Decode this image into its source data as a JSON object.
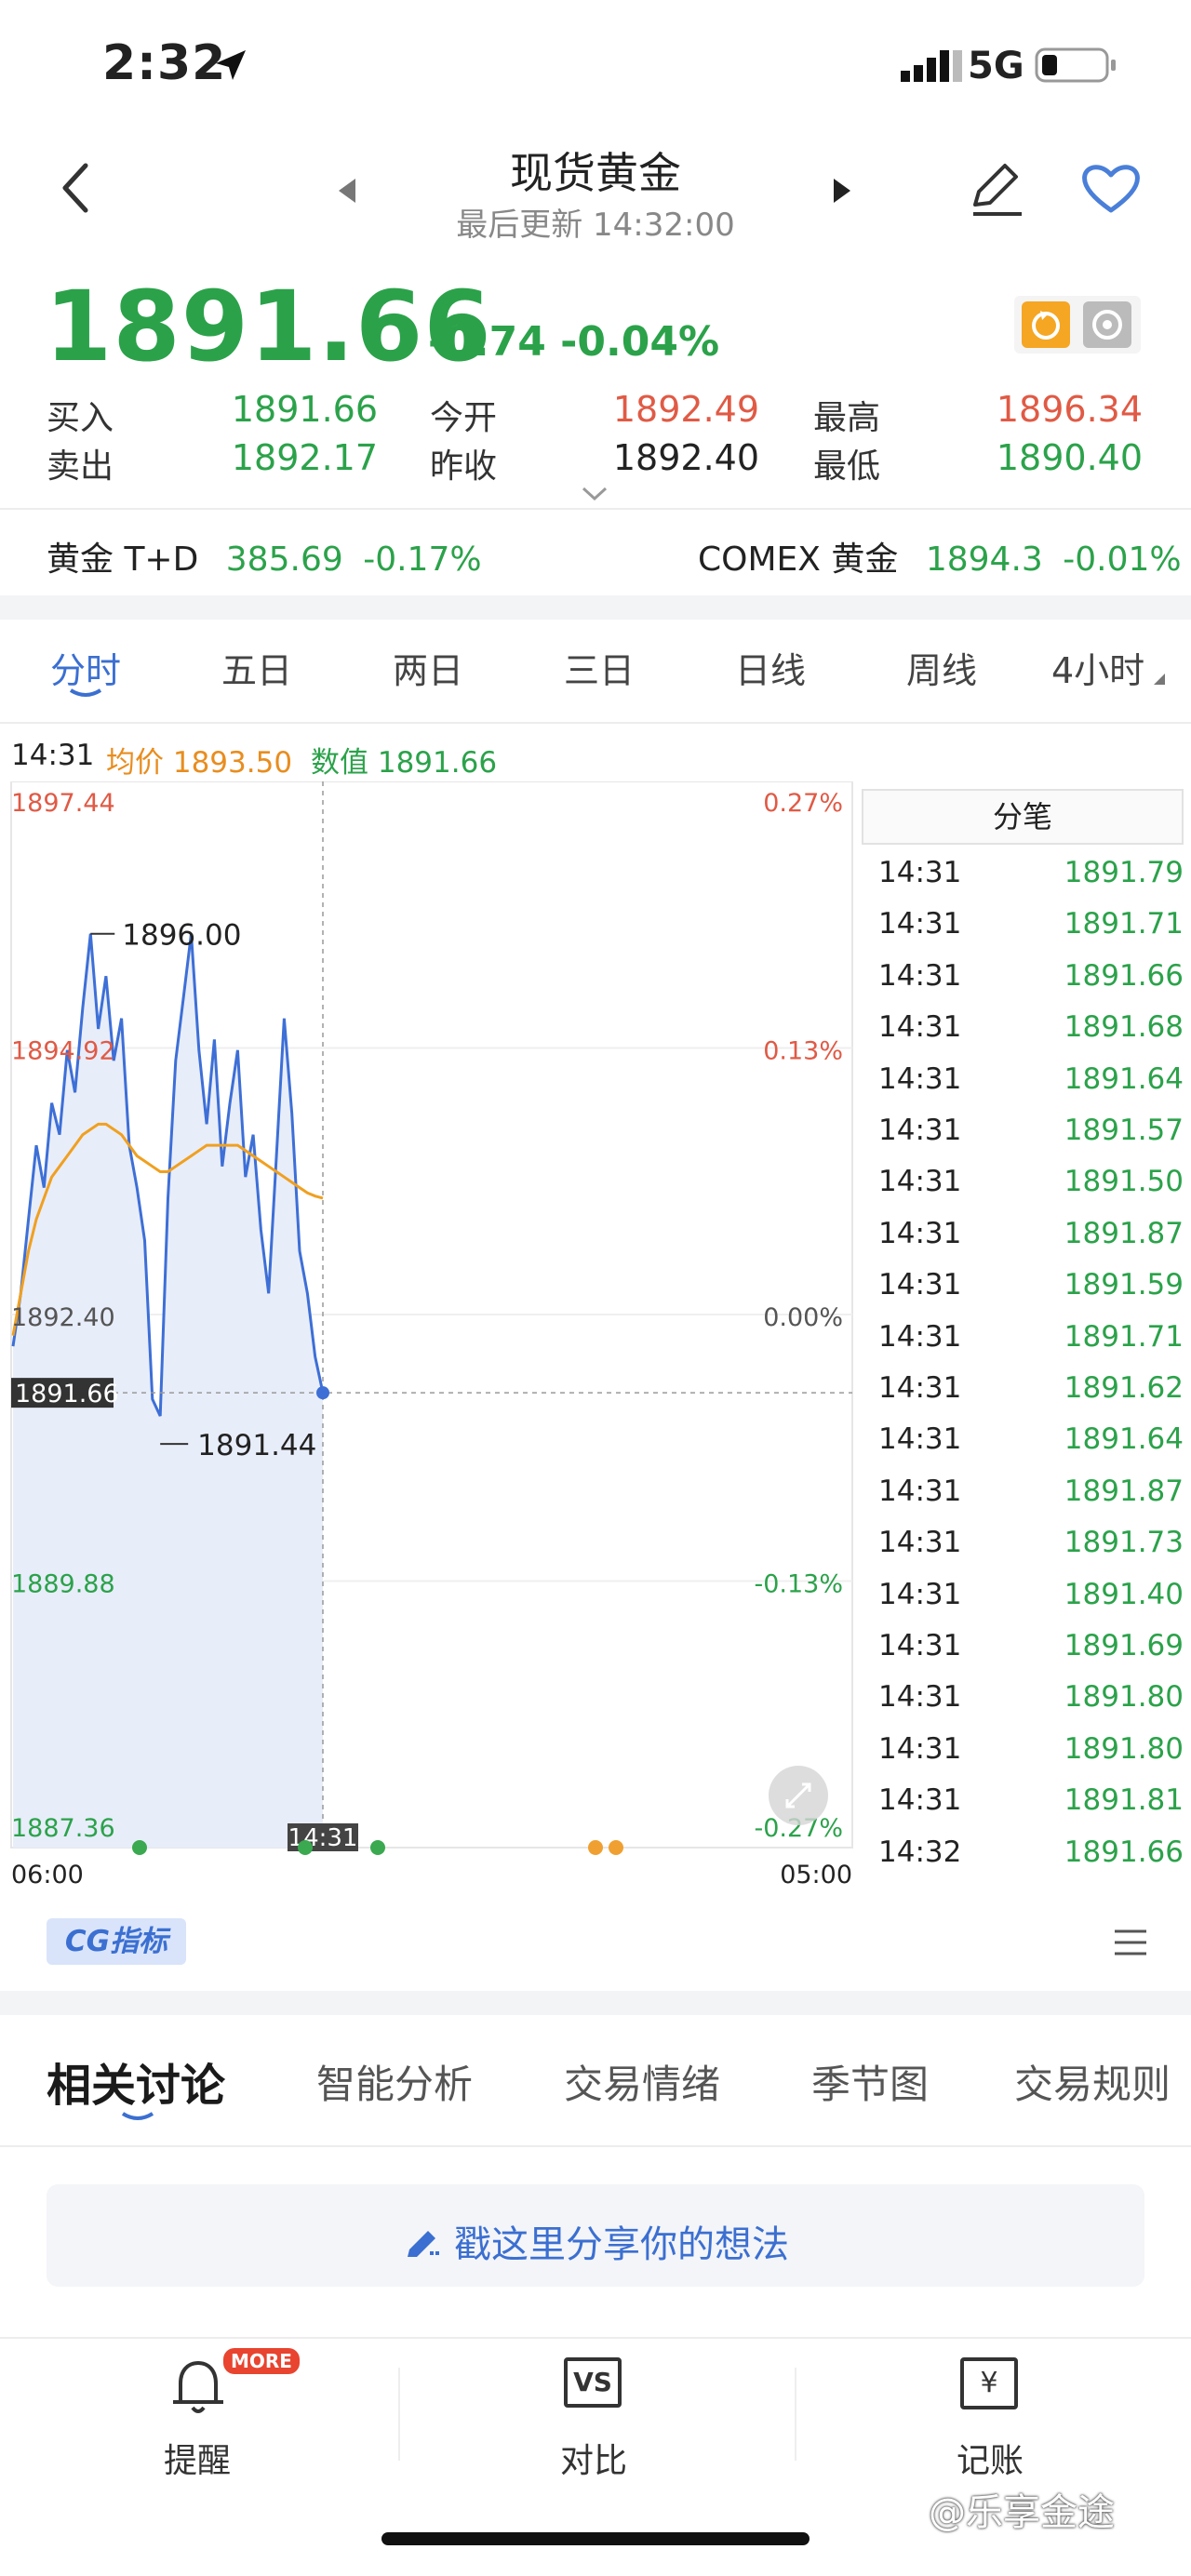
{
  "status": {
    "time": "2:32",
    "network": "5G"
  },
  "nav": {
    "title": "现货黄金",
    "subtitle": "最后更新 14:32:00"
  },
  "quote": {
    "price": "1891.66",
    "change": "-0.74 -0.04%",
    "buy_label": "买入",
    "buy": "1891.66",
    "sell_label": "卖出",
    "sell": "1892.17",
    "open_label": "今开",
    "open": "1892.49",
    "prev_label": "昨收",
    "prev": "1892.40",
    "high_label": "最高",
    "high": "1896.34",
    "low_label": "最低",
    "low": "1890.40"
  },
  "related": [
    {
      "name": "黄金 T+D",
      "value": "385.69",
      "change": "-0.17%"
    },
    {
      "name": "COMEX 黄金",
      "value": "1894.3",
      "change": "-0.01%"
    }
  ],
  "tabs": [
    "分时",
    "五日",
    "两日",
    "三日",
    "日线",
    "周线",
    "4小时"
  ],
  "legend": {
    "time": "14:31",
    "avg_label": "均价",
    "avg": "1893.50",
    "val_label": "数值",
    "val": "1891.66"
  },
  "chart_data": {
    "type": "line",
    "title": "",
    "x_start": "06:00",
    "x_end": "05:00",
    "ylim": [
      1887.36,
      1897.44
    ],
    "y_ticks": [
      "1897.44",
      "1894.92",
      "1892.40",
      "1889.88",
      "1887.36"
    ],
    "pct_ticks": [
      "0.27%",
      "0.13%",
      "0.00%",
      "-0.13%",
      "-0.27%"
    ],
    "current_label": "1891.66",
    "cursor_time": "14:31",
    "max_label": "1896.00",
    "min_label": "1891.44",
    "series": [
      {
        "values": [
          1892.1,
          1892.6,
          1893.3,
          1894.0,
          1893.6,
          1894.4,
          1894.1,
          1894.9,
          1894.5,
          1895.3,
          1896.0,
          1895.1,
          1895.6,
          1894.8,
          1895.2,
          1894.0,
          1893.6,
          1893.1,
          1891.6,
          1891.44,
          1893.5,
          1894.8,
          1895.4,
          1896.0,
          1894.9,
          1894.2,
          1895.0,
          1893.8,
          1894.4,
          1894.9,
          1893.7,
          1894.1,
          1893.2,
          1892.6,
          1893.9,
          1895.2,
          1894.3,
          1893.0,
          1892.6,
          1892.0,
          1891.66
        ]
      },
      {
        "values": [
          1892.2,
          1892.6,
          1893.0,
          1893.3,
          1893.5,
          1893.7,
          1893.8,
          1893.9,
          1894.0,
          1894.1,
          1894.15,
          1894.2,
          1894.2,
          1894.15,
          1894.1,
          1894.0,
          1893.9,
          1893.85,
          1893.8,
          1893.75,
          1893.75,
          1893.8,
          1893.85,
          1893.9,
          1893.95,
          1894.0,
          1894.0,
          1894.0,
          1894.0,
          1894.0,
          1893.95,
          1893.9,
          1893.85,
          1893.8,
          1893.75,
          1893.7,
          1893.65,
          1893.6,
          1893.55,
          1893.52,
          1893.5
        ]
      }
    ]
  },
  "ticks": {
    "header": "分笔",
    "rows": [
      {
        "time": "14:31",
        "value": "1891.79"
      },
      {
        "time": "14:31",
        "value": "1891.71"
      },
      {
        "time": "14:31",
        "value": "1891.66"
      },
      {
        "time": "14:31",
        "value": "1891.68"
      },
      {
        "time": "14:31",
        "value": "1891.64"
      },
      {
        "time": "14:31",
        "value": "1891.57"
      },
      {
        "time": "14:31",
        "value": "1891.50"
      },
      {
        "time": "14:31",
        "value": "1891.87"
      },
      {
        "time": "14:31",
        "value": "1891.59"
      },
      {
        "time": "14:31",
        "value": "1891.71"
      },
      {
        "time": "14:31",
        "value": "1891.62"
      },
      {
        "time": "14:31",
        "value": "1891.64"
      },
      {
        "time": "14:31",
        "value": "1891.87"
      },
      {
        "time": "14:31",
        "value": "1891.73"
      },
      {
        "time": "14:31",
        "value": "1891.40"
      },
      {
        "time": "14:31",
        "value": "1891.69"
      },
      {
        "time": "14:31",
        "value": "1891.80"
      },
      {
        "time": "14:31",
        "value": "1891.80"
      },
      {
        "time": "14:31",
        "value": "1891.81"
      },
      {
        "time": "14:32",
        "value": "1891.66"
      }
    ]
  },
  "cg_label": "CG指标",
  "bottom_tabs": [
    "相关讨论",
    "智能分析",
    "交易情绪",
    "季节图",
    "交易规则"
  ],
  "share_placeholder": "戳这里分享你的想法",
  "toolbar": {
    "remind": "提醒",
    "more_badge": "MORE",
    "compare": "对比",
    "compare_icon_text": "VS",
    "ledger": "记账",
    "ledger_icon_text": "¥"
  },
  "watermark": "@乐享金途",
  "colors": {
    "up": "#e05a45",
    "down": "#2ba24a",
    "accent": "#3b6fd1",
    "avg_line": "#f0a020",
    "price_line": "#3d6fd6"
  }
}
